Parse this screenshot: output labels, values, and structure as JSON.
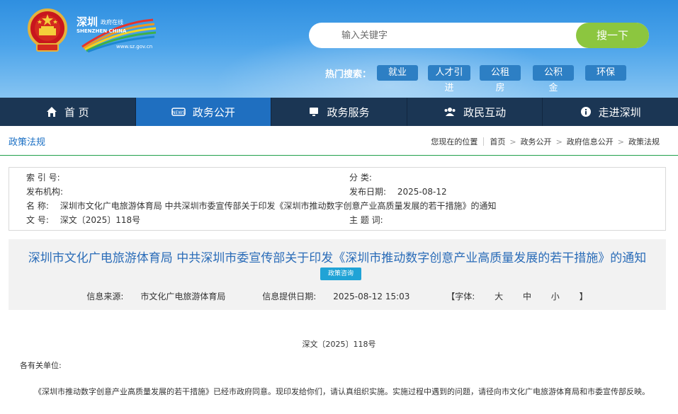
{
  "header": {
    "site_name_cn": "深圳",
    "site_name_sub": "政府在线",
    "site_name_en": "SHENZHEN CHINA",
    "site_url": "www.sz.gov.cn",
    "search": {
      "placeholder": "输入关键字",
      "button_label": "搜一下"
    },
    "hot_label": "热门搜索：",
    "hot_tags": [
      "就业",
      "人才引进",
      "公租房",
      "公积金",
      "环保"
    ]
  },
  "nav": {
    "items": [
      {
        "label": "首 页",
        "icon": "home-icon"
      },
      {
        "label": "政务公开",
        "icon": "news-icon"
      },
      {
        "label": "政务服务",
        "icon": "monitor-icon"
      },
      {
        "label": "政民互动",
        "icon": "people-icon"
      },
      {
        "label": "走进深圳",
        "icon": "info-icon"
      }
    ],
    "active_index": 1
  },
  "breadcrumb": {
    "section_title": "政策法规",
    "location_label": "您现在的位置",
    "items": [
      "首页",
      "政务公开",
      "政府信息公开",
      "政策法规"
    ]
  },
  "info": {
    "index_label": "索 引 号:",
    "index_value": "",
    "category_label": "分 类:",
    "category_value": "",
    "issuer_label": "发布机构:",
    "issuer_value": "",
    "date_label": "发布日期:",
    "date_value": "2025-08-12",
    "name_label": "名 称:",
    "name_value": "深圳市文化广电旅游体育局 中共深圳市委宣传部关于印发《深圳市推动数字创意产业高质量发展的若干措施》的通知",
    "docno_label": "文 号:",
    "docno_value": "深文〔2025〕118号",
    "keyword_label": "主 题 词:",
    "keyword_value": ""
  },
  "article": {
    "title": "深圳市文化广电旅游体育局 中共深圳市委宣传部关于印发《深圳市推动数字创意产业高质量发展的若干措施》的通知",
    "badge": "政策咨询",
    "source_label": "信息来源:",
    "source_value": "市文化广电旅游体育局",
    "provided_label": "信息提供日期:",
    "provided_value": "2025-08-12 15:03",
    "font_label": "【字体:",
    "font_large": "大",
    "font_medium": "中",
    "font_small": "小",
    "font_end": "】",
    "doc_no": "深文〔2025〕118号",
    "salutation": "各有关单位:",
    "paragraph": "《深圳市推动数字创意产业高质量发展的若干措施》已经市政府同意。现印发给你们，请认真组织实施。实施过程中遇到的问题，请径向市文化广电旅游体育局和市委宣传部反映。"
  },
  "colors": {
    "nav_bg": "#1b3654",
    "nav_active": "#1f6fc0",
    "search_button": "#8cc63f",
    "title_blue": "#2a6cb8",
    "badge": "#20a3d6",
    "divider_green": "#21a04b"
  }
}
